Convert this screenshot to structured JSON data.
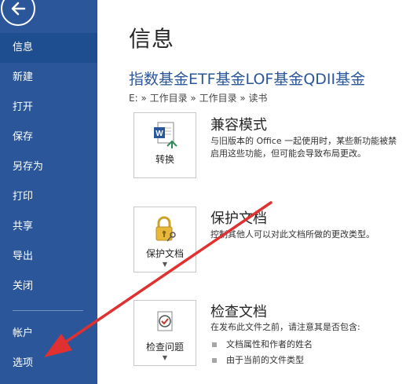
{
  "sidebar": {
    "items": [
      {
        "label": "信息",
        "active": true
      },
      {
        "label": "新建"
      },
      {
        "label": "打开"
      },
      {
        "label": "保存"
      },
      {
        "label": "另存为"
      },
      {
        "label": "打印"
      },
      {
        "label": "共享"
      },
      {
        "label": "导出"
      },
      {
        "label": "关闭"
      },
      {
        "label": "帐户"
      },
      {
        "label": "选项"
      }
    ]
  },
  "main": {
    "page_title": "信息",
    "doc_title": "指数基金ETF基金LOF基金QDII基金",
    "breadcrumb": "E: » 工作目录 » 工作目录 » 读书",
    "compat": {
      "button_label": "转换",
      "title": "兼容模式",
      "desc1": "与旧版本的 Office 一起使用时，某些新功能被禁",
      "desc2": "启用这些功能，但可能会导致布局更改。"
    },
    "protect": {
      "button_label": "保护文档",
      "title": "保护文档",
      "desc": "控制其他人可以对此文档所做的更改类型。"
    },
    "inspect": {
      "button_label": "检查问题",
      "title": "检查文档",
      "desc": "在发布此文件之前，请注意其是否包含:",
      "bullets": [
        "文档属性和作者的姓名",
        "由于当前的文件类型"
      ]
    }
  },
  "colors": {
    "sidebar": "#2b579a",
    "active_item": "#1e4e8f",
    "accent_text": "#2b579a",
    "annotation_arrow": "#e03030"
  }
}
